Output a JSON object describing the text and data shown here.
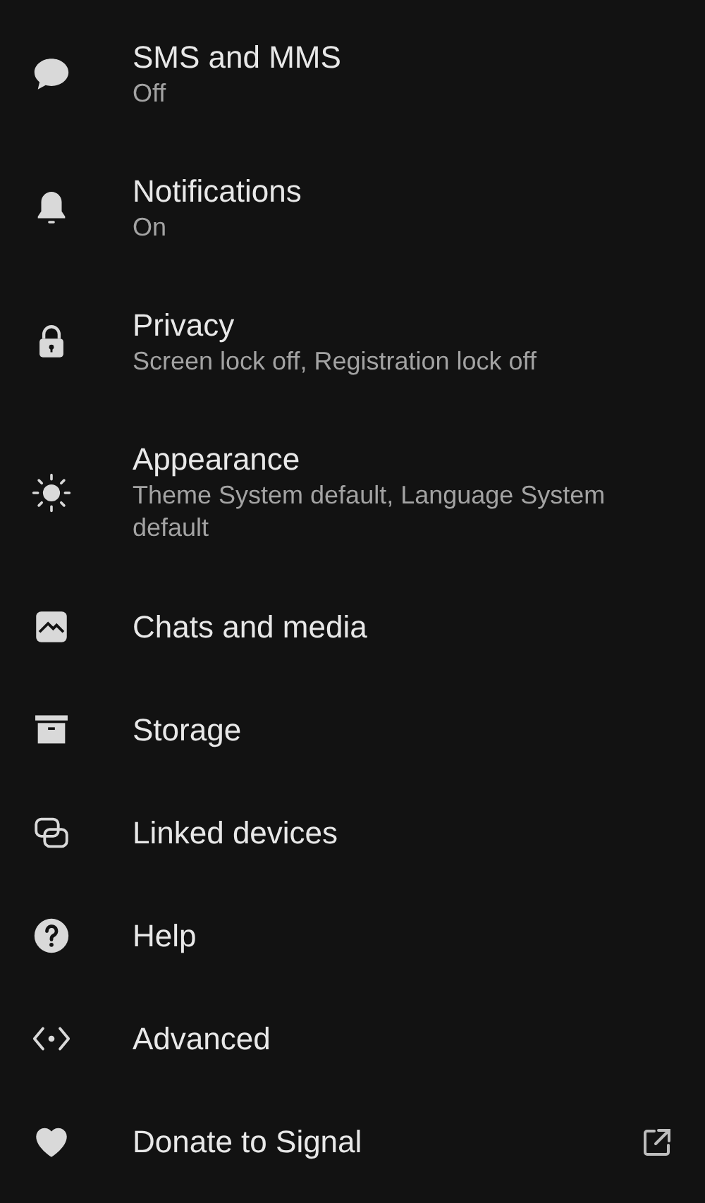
{
  "settings": [
    {
      "title": "SMS and MMS",
      "subtitle": "Off"
    },
    {
      "title": "Notifications",
      "subtitle": "On"
    },
    {
      "title": "Privacy",
      "subtitle": "Screen lock off, Registration lock off"
    },
    {
      "title": "Appearance",
      "subtitle": "Theme System default, Language System default"
    },
    {
      "title": "Chats and media"
    },
    {
      "title": "Storage"
    },
    {
      "title": "Linked devices"
    },
    {
      "title": "Help"
    },
    {
      "title": "Advanced"
    },
    {
      "title": "Donate to Signal",
      "external": true
    }
  ]
}
